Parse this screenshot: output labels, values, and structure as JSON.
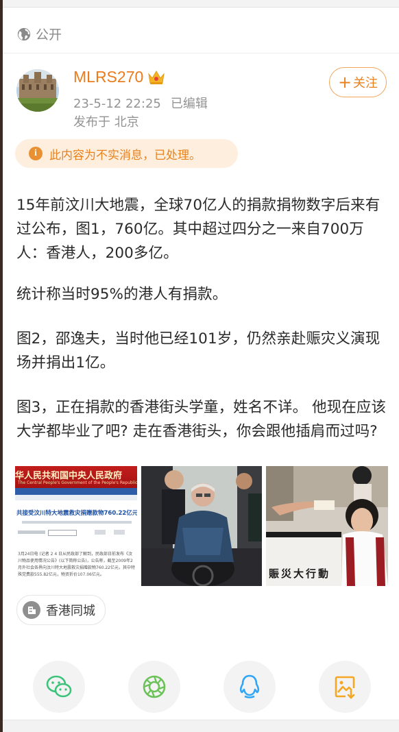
{
  "visibility": {
    "label": "公开",
    "icon": "globe-icon"
  },
  "author": {
    "name": "MLRS270",
    "badge_icon": "crown-icon",
    "datetime": "23-5-12 22:25",
    "edited": "已编辑",
    "location": "发布于 北京"
  },
  "follow_button": {
    "label": "关注"
  },
  "notice": {
    "icon": "info-icon",
    "text": "此内容为不实消息，已处理。"
  },
  "post": {
    "paragraphs": [
      "15年前汶川大地震，全球70亿人的捐款捐物数字后来有过公布，图1，760亿。其中超过四分之一来自700万人：香港人，200多亿。",
      "统计称当时95%的港人有捐款。",
      "图2，邵逸夫，当时他已经101岁，仍然亲赴赈灾义演现场并捐出1亿。",
      "图3，正在捐款的香港街头学童，姓名不详。 他现在应该大学都毕业了吧? 走在香港街头，你会跟他插肩而过吗?"
    ]
  },
  "images": {
    "img1": {
      "banner": "华人民共和国中央人民政府",
      "banner_en": "The Central People's Government of the People's Republic of China",
      "headline": "共接受汶川特大地震救灾捐赠款物760.22亿元",
      "footer_text": "3月24日电 (记者 2 4 日从民政部了解到，民政部日前发布《汶川物品使用情况公告》(以下简称公告)，公告称，截至2009年2月外社会各界向汶川特大地震救灾捐赠款物760.22亿元，其中特殊党费款555.82亿元，物资折价107.06亿元。"
    },
    "img3": {
      "sign": "賑災大行動"
    }
  },
  "topic_tag": {
    "label": "香港同城",
    "icon": "building-icon"
  },
  "share": [
    {
      "name": "wechat",
      "icon": "wechat-icon",
      "color": "#3cc37a"
    },
    {
      "name": "moments",
      "icon": "moments-icon",
      "color": "#6ac259"
    },
    {
      "name": "qq",
      "icon": "qq-icon",
      "color": "#2fa6f5"
    },
    {
      "name": "save-image",
      "icon": "save-image-icon",
      "color": "#f5a623"
    }
  ],
  "colors": {
    "accent": "#ea7c1e",
    "notice_bg": "#fdeedd",
    "text": "#2a2a2a",
    "muted": "#939393"
  }
}
